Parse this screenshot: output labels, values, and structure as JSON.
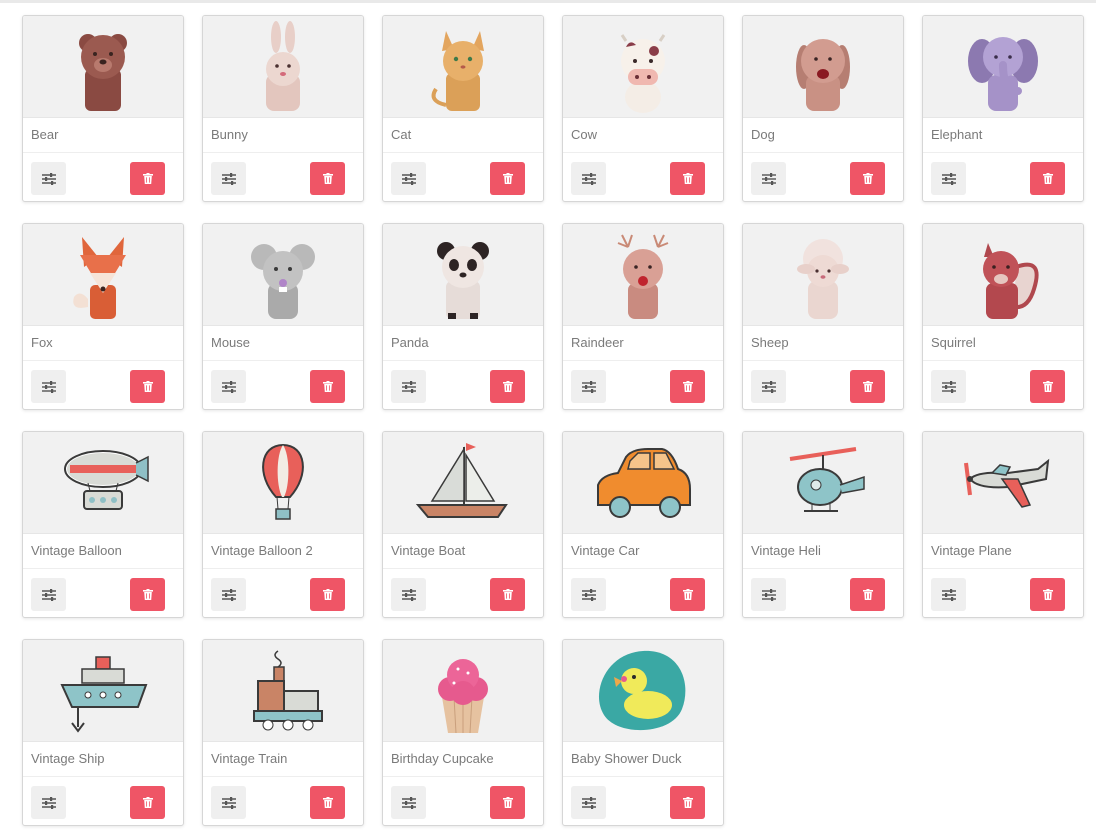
{
  "items": [
    {
      "name": "Bear",
      "icon": "bear-icon"
    },
    {
      "name": "Bunny",
      "icon": "bunny-icon"
    },
    {
      "name": "Cat",
      "icon": "cat-icon"
    },
    {
      "name": "Cow",
      "icon": "cow-icon"
    },
    {
      "name": "Dog",
      "icon": "dog-icon"
    },
    {
      "name": "Elephant",
      "icon": "elephant-icon"
    },
    {
      "name": "Fox",
      "icon": "fox-icon"
    },
    {
      "name": "Mouse",
      "icon": "mouse-icon"
    },
    {
      "name": "Panda",
      "icon": "panda-icon"
    },
    {
      "name": "Raindeer",
      "icon": "raindeer-icon"
    },
    {
      "name": "Sheep",
      "icon": "sheep-icon"
    },
    {
      "name": "Squirrel",
      "icon": "squirrel-icon"
    },
    {
      "name": "Vintage Balloon",
      "icon": "vintage-balloon-icon"
    },
    {
      "name": "Vintage Balloon 2",
      "icon": "vintage-balloon-2-icon"
    },
    {
      "name": "Vintage Boat",
      "icon": "vintage-boat-icon"
    },
    {
      "name": "Vintage Car",
      "icon": "vintage-car-icon"
    },
    {
      "name": "Vintage Heli",
      "icon": "vintage-heli-icon"
    },
    {
      "name": "Vintage Plane",
      "icon": "vintage-plane-icon"
    },
    {
      "name": "Vintage Ship",
      "icon": "vintage-ship-icon"
    },
    {
      "name": "Vintage Train",
      "icon": "vintage-train-icon"
    },
    {
      "name": "Birthday Cupcake",
      "icon": "birthday-cupcake-icon"
    },
    {
      "name": "Baby Shower Duck",
      "icon": "baby-shower-duck-icon"
    }
  ],
  "colors": {
    "delete_button": "#ef5566",
    "settings_button": "#efefef",
    "thumb_background": "#f1f1f1",
    "label_text": "#7a7a7a"
  },
  "icons": {
    "settings": "sliders-icon",
    "delete": "trash-icon"
  }
}
